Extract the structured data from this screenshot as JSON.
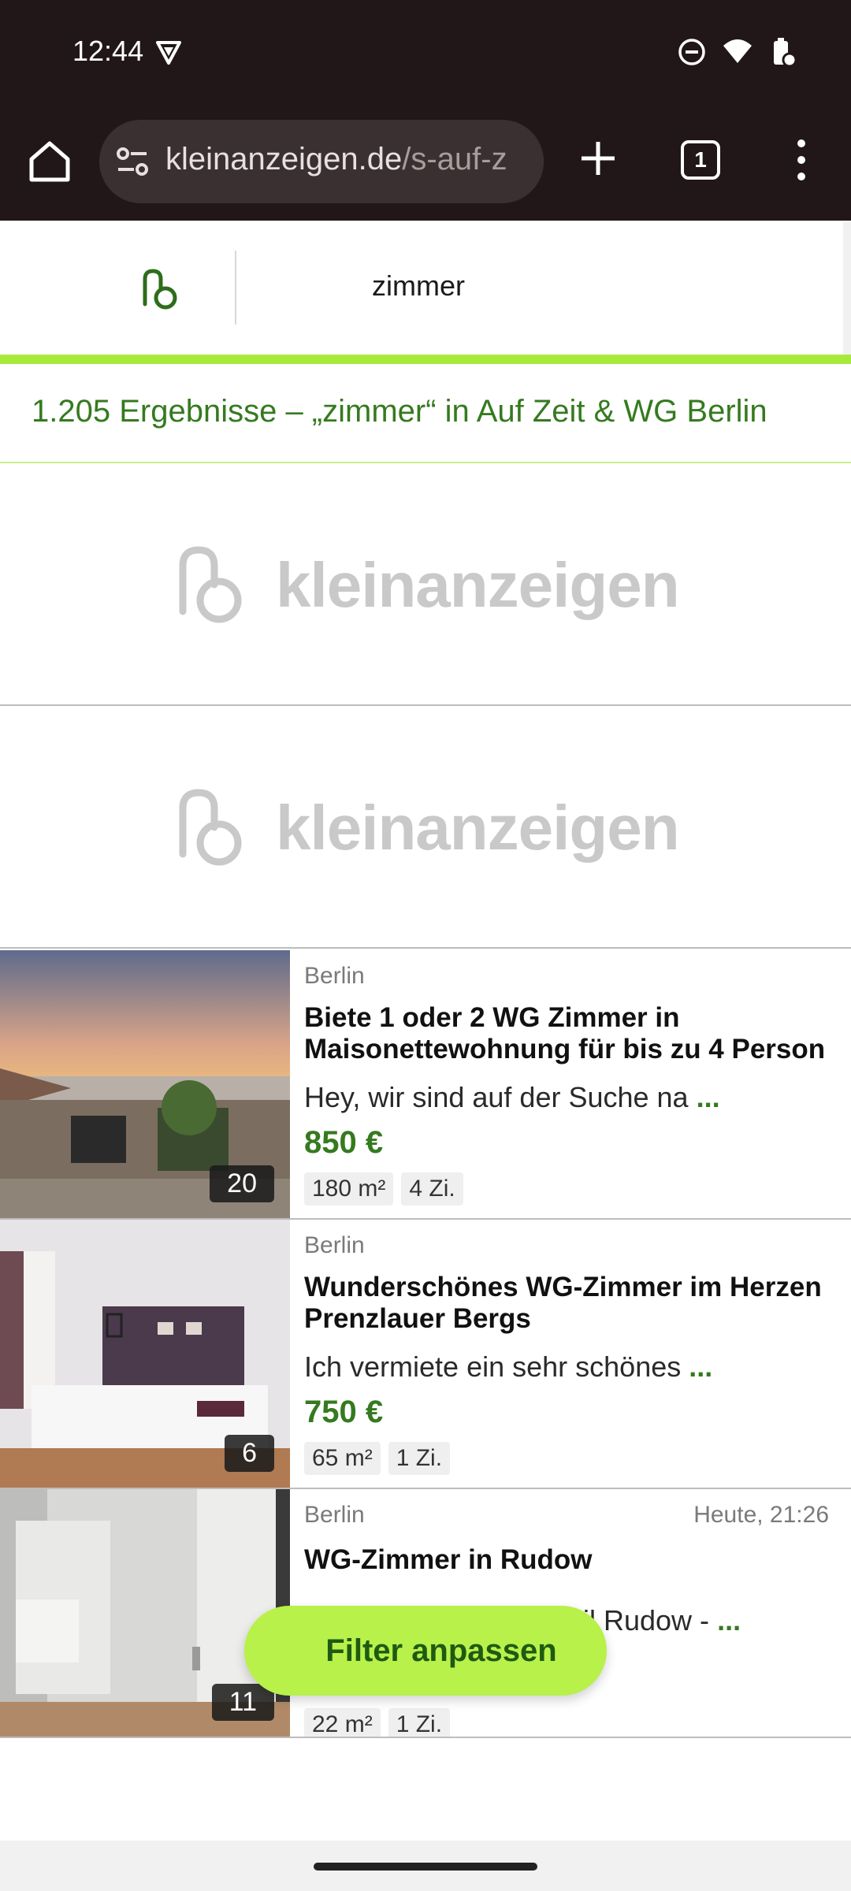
{
  "status_bar": {
    "time": "12:44"
  },
  "browser": {
    "url_host": "kleinanzeigen.de",
    "url_path": "/s-auf-z",
    "tab_count": "1"
  },
  "header": {
    "search_query": "zimmer"
  },
  "results": {
    "summary": "1.205 Ergebnisse – „zimmer“ in Auf Zeit & WG Berlin"
  },
  "ads": [
    {
      "brand": "kleinanzeigen"
    },
    {
      "brand": "kleinanzeigen"
    }
  ],
  "listings": [
    {
      "location": "Berlin",
      "date": "",
      "title": "Biete 1 oder 2 WG Zimmer in Maisonettewohnung für bis zu 4 Person",
      "description": "Hey, wir sind auf der Suche na",
      "more": "...",
      "price": "850 €",
      "tags": [
        "180 m²",
        "4 Zi."
      ],
      "image_count": "20"
    },
    {
      "location": "Berlin",
      "date": "",
      "title": "Wunderschönes WG-Zimmer im Herzen Prenzlauer Bergs",
      "description": "Ich vermiete ein sehr schönes",
      "more": "...",
      "price": "750 €",
      "tags": [
        "65 m²",
        "1 Zi."
      ],
      "image_count": "6"
    },
    {
      "location": "Berlin",
      "date": "Heute, 21:26",
      "title": "WG-Zimmer in Rudow",
      "description": "il Rudow -",
      "more": "...",
      "price": "",
      "tags": [
        "22 m²",
        "1 Zi."
      ],
      "image_count": "11"
    }
  ],
  "fab": {
    "label": "Filter anpassen"
  },
  "colors": {
    "accent": "#357a1f",
    "brand_green": "#a8ea3c",
    "chrome": "#221718"
  }
}
